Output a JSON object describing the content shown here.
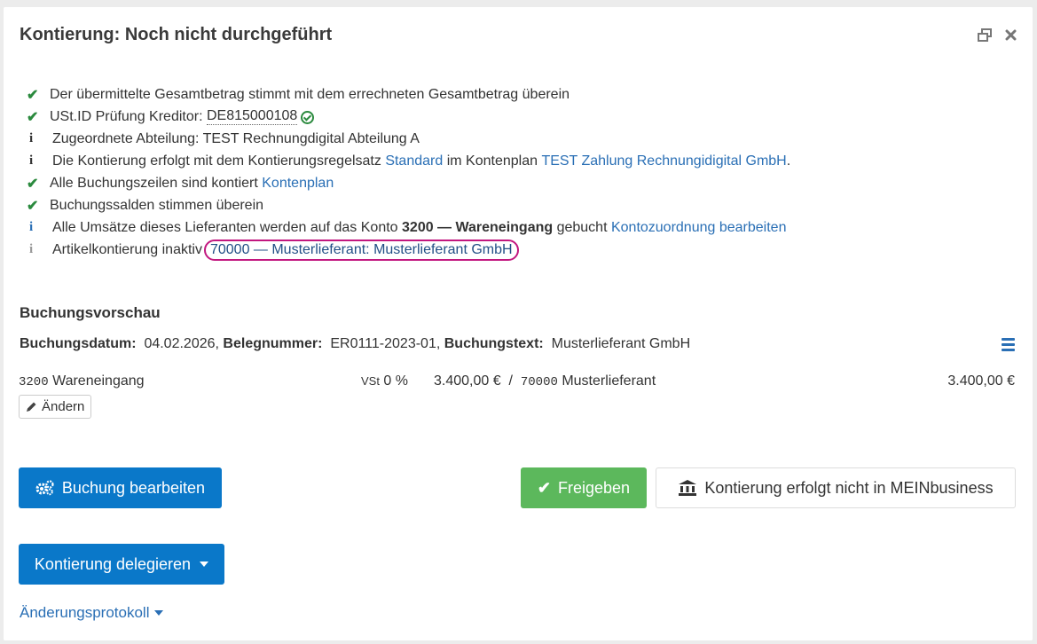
{
  "dialog": {
    "title": "Kontierung: Noch nicht durchgeführt"
  },
  "checks": [
    {
      "icon": "check-icon",
      "text": "Der übermittelte Gesamtbetrag stimmt mit dem errechneten Gesamtbetrag überein"
    },
    {
      "icon": "check-icon",
      "prefix": "USt.ID Prüfung Kreditor: ",
      "value": "DE815000108"
    },
    {
      "icon": "info-icon",
      "text": "Zugeordnete Abteilung: TEST Rechnungdigital Abteilung A"
    },
    {
      "icon": "info-icon",
      "prefix": "Die Kontierung erfolgt mit dem Kontierungsregelsatz ",
      "link1": "Standard",
      "middle": " im Kontenplan ",
      "link2": "TEST Zahlung Rechnungidigital GmbH",
      "suffix": "."
    },
    {
      "icon": "check-icon",
      "prefix": "Alle Buchungszeilen sind kontiert ",
      "link": "Kontenplan"
    },
    {
      "icon": "check-icon",
      "text": "Buchungssalden stimmen überein"
    },
    {
      "icon": "info-icon",
      "prefix": "Alle Umsätze dieses Lieferanten werden auf das Konto ",
      "bold": "3200 — Wareneingang",
      "middle": " gebucht ",
      "link": "Kontozuordnung bearbeiten"
    },
    {
      "icon": "info-icon",
      "prefix": "Artikelkontierung inaktiv",
      "link": "70000 — Musterlieferant: Musterlieferant GmbH"
    }
  ],
  "preview": {
    "title": "Buchungsvorschau",
    "date_label": "Buchungsdatum:",
    "date_value": "04.02.2026,",
    "beleg_label": "Belegnummer:",
    "beleg_value": "ER0111-2023-01,",
    "text_label": "Buchungstext:",
    "text_value": "Musterlieferant GmbH",
    "row": {
      "account_no": "3200",
      "account_name": "Wareneingang",
      "vst_label": "VSt",
      "vst_value": "0 %",
      "amount": "3.400,00 €",
      "sep": "/",
      "creditor_no": "70000",
      "creditor_name": "Musterlieferant",
      "total": "3.400,00 €"
    },
    "change_label": "Ändern"
  },
  "buttons": {
    "edit": "Buchung bearbeiten",
    "approve": "Freigeben",
    "external": "Kontierung erfolgt nicht in MEINbusiness",
    "delegate": "Kontierung delegieren",
    "log": "Änderungsprotokoll"
  },
  "colors": {
    "primary": "#0a78c9",
    "success": "#5cb85c",
    "check": "#2b8a3e",
    "link": "#2a6fb5",
    "highlight": "#c2177f"
  }
}
